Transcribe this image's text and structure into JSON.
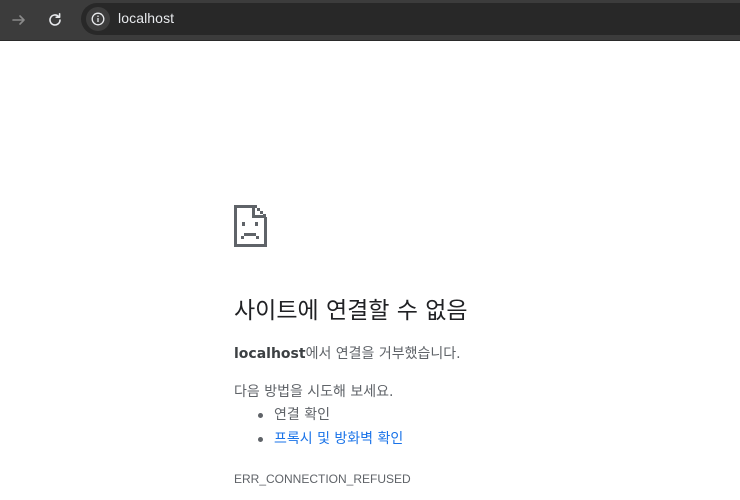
{
  "browser": {
    "address_bar": {
      "url": "localhost",
      "info_icon": "info-icon"
    },
    "nav": {
      "forward_icon": "arrow-right-icon",
      "reload_icon": "reload-icon"
    }
  },
  "error_page": {
    "icon": "sad-page-icon",
    "title": "사이트에 연결할 수 없음",
    "summary_host": "localhost",
    "summary_rest": "에서 연결을 거부했습니다.",
    "suggestions_heading": "다음 방법을 시도해 보세요.",
    "suggestions": [
      {
        "label": "연결 확인",
        "is_link": false
      },
      {
        "label": "프록시 및 방화벽 확인",
        "is_link": true
      }
    ],
    "error_code": "ERR_CONNECTION_REFUSED",
    "colors": {
      "link": "#1a73e8",
      "text": "#5f6368",
      "title": "#202124"
    }
  }
}
